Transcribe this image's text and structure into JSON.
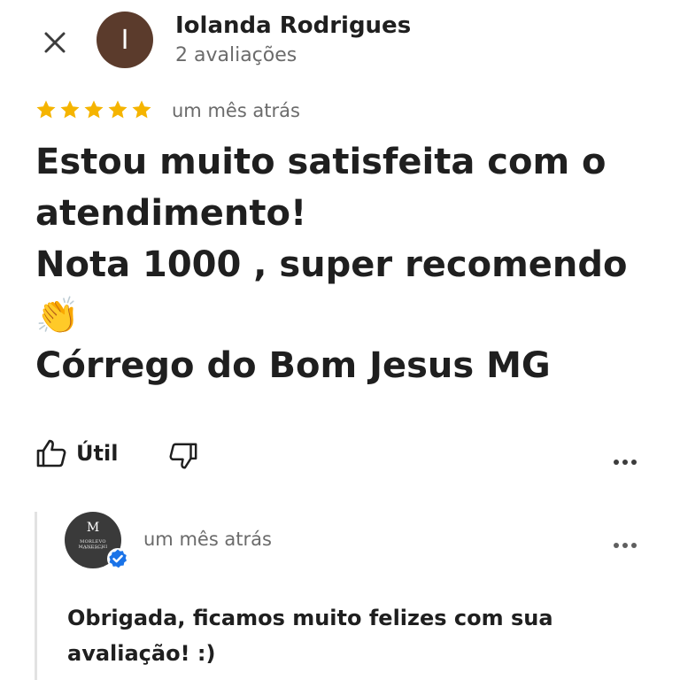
{
  "header": {
    "close_icon": "close-icon",
    "avatar_initial": "I",
    "avatar_color": "#5b3b2c",
    "reviewer_name": "Iolanda Rodrigues",
    "reviewer_review_count": "2 avaliações"
  },
  "review": {
    "rating": 5,
    "rating_max": 5,
    "star_color": "#f5b400",
    "time_ago": "um mês atrás",
    "text_lines": [
      "Estou muito satisfeita com o",
      "atendimento!",
      "Nota 1000 , super recomendo",
      "👏",
      "Córrego do Bom Jesus MG"
    ]
  },
  "actions": {
    "useful_label": "Útil",
    "useful_icon": "thumbs-up-icon",
    "not_useful_icon": "thumbs-down-icon",
    "more_icon": "more-horizontal-icon"
  },
  "owner_reply": {
    "avatar_logo_letter": "M",
    "avatar_logo_name": "MORLEVO MANESCHI",
    "avatar_logo_subtitle": "ADVOCACIA",
    "verified_icon": "verified-badge-icon",
    "verified_color": "#1a73e8",
    "time_ago": "um mês atrás",
    "more_icon": "more-horizontal-icon",
    "text_lines": [
      "Obrigada, ficamos muito felizes com sua",
      "avaliação! :)"
    ]
  }
}
